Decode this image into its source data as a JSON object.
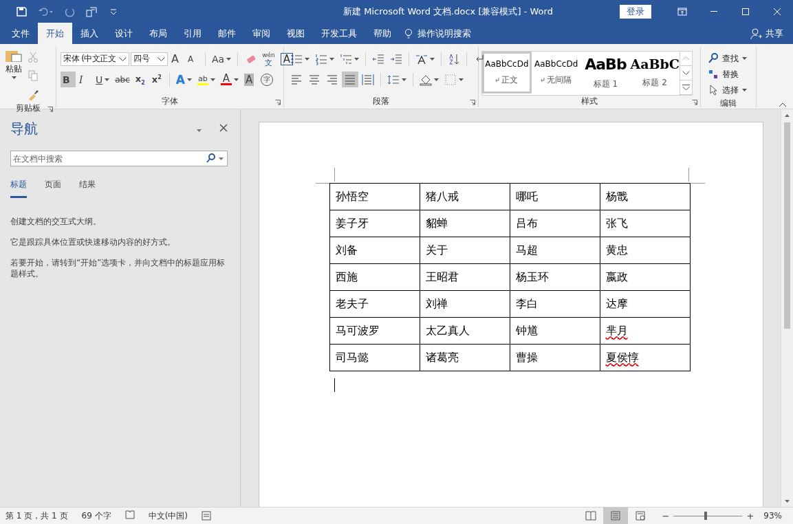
{
  "window": {
    "title": "新建 Microsoft Word 文档.docx [兼容模式]  -  Word",
    "signin": "登录"
  },
  "tabs": [
    {
      "label": "文件",
      "selected": false
    },
    {
      "label": "开始",
      "selected": true
    },
    {
      "label": "插入",
      "selected": false
    },
    {
      "label": "设计",
      "selected": false
    },
    {
      "label": "布局",
      "selected": false
    },
    {
      "label": "引用",
      "selected": false
    },
    {
      "label": "邮件",
      "selected": false
    },
    {
      "label": "审阅",
      "selected": false
    },
    {
      "label": "视图",
      "selected": false
    },
    {
      "label": "开发工具",
      "selected": false
    },
    {
      "label": "帮助",
      "selected": false
    }
  ],
  "tell_me": "操作说明搜索",
  "share": "共享",
  "clipboard": {
    "paste": "粘贴",
    "label": "剪贴板"
  },
  "font": {
    "label": "字体",
    "font_name": "宋体 (中文正文",
    "font_size": "四号",
    "row1": [
      {
        "kind": "grow",
        "text": "A"
      },
      {
        "kind": "shrink",
        "text": "A"
      },
      {
        "kind": "case",
        "text": "Aa",
        "dropdown": true,
        "sep": true
      },
      {
        "kind": "clear",
        "sep": true
      },
      {
        "kind": "phonetic",
        "text": "wén",
        "sub": "文"
      },
      {
        "kind": "border",
        "text": "A"
      }
    ],
    "row2": [
      {
        "kind": "bold",
        "text": "B",
        "selected": true
      },
      {
        "kind": "italic",
        "text": "I",
        "selected": false
      },
      {
        "kind": "underline",
        "text": "U",
        "selected": false,
        "dropdown": true
      },
      {
        "kind": "strike",
        "text": "abc",
        "selected": false
      },
      {
        "kind": "sub",
        "text": "x",
        "script": "2",
        "selected": false
      },
      {
        "kind": "sup",
        "text": "x",
        "script": "2",
        "selected": false
      },
      {
        "kind": "effect",
        "text": "A",
        "selected": false,
        "dropdown": true,
        "sep": true
      },
      {
        "kind": "highlight",
        "text": "ab",
        "color": "#ffff00",
        "selected": false,
        "dropdown": true
      },
      {
        "kind": "color",
        "text": "A",
        "color": "#ff0000",
        "selected": false,
        "dropdown": true
      },
      {
        "kind": "shade",
        "text": "A",
        "selected": false
      },
      {
        "kind": "enclose",
        "text": "字",
        "selected": false
      }
    ]
  },
  "paragraph": {
    "label": "段落",
    "alignments": [
      {
        "kind": "left",
        "selected": false
      },
      {
        "kind": "center",
        "selected": false
      },
      {
        "kind": "right",
        "selected": false
      },
      {
        "kind": "justify",
        "selected": true
      },
      {
        "kind": "distribute",
        "selected": false
      }
    ]
  },
  "styles": {
    "label": "样式",
    "items": [
      {
        "kind": "normal",
        "preview": "AaBbCcDd",
        "name": "正文",
        "selected": true
      },
      {
        "kind": "normal",
        "preview": "AaBbCcDd",
        "name": "无间隔",
        "selected": false
      },
      {
        "kind": "h1",
        "preview": "AaBb",
        "name": "标题 1",
        "selected": false
      },
      {
        "kind": "h2",
        "preview": "AaBbC",
        "name": "标题 2",
        "selected": false
      }
    ]
  },
  "editing": {
    "label": "编辑",
    "items": [
      {
        "kind": "find",
        "label": "查找",
        "dropdown": true
      },
      {
        "kind": "replace",
        "label": "替换",
        "dropdown": false
      },
      {
        "kind": "select",
        "label": "选择",
        "dropdown": true
      }
    ]
  },
  "navigation": {
    "title": "导航",
    "search": {
      "placeholder": "在文档中搜索"
    },
    "tabs": [
      {
        "label": "标题",
        "selected": true
      },
      {
        "label": "页面",
        "selected": false
      },
      {
        "label": "结果",
        "selected": false
      }
    ],
    "paragraphs": [
      "创建文档的交互式大纲。",
      "它是跟踪具体位置或快速移动内容的好方式。",
      "若要开始，请转到“开始”选项卡，并向文档中的标题应用标题样式。"
    ]
  },
  "table": {
    "rows": [
      [
        {
          "text": "孙悟空",
          "misspelled": false
        },
        {
          "text": "猪八戒",
          "misspelled": false
        },
        {
          "text": "哪吒",
          "misspelled": false
        },
        {
          "text": "杨戬",
          "misspelled": false
        }
      ],
      [
        {
          "text": "姜子牙",
          "misspelled": false
        },
        {
          "text": "貂蝉",
          "misspelled": false
        },
        {
          "text": "吕布",
          "misspelled": false
        },
        {
          "text": "张飞",
          "misspelled": false
        }
      ],
      [
        {
          "text": "刘备",
          "misspelled": false
        },
        {
          "text": "关于",
          "misspelled": false
        },
        {
          "text": "马超",
          "misspelled": false
        },
        {
          "text": "黄忠",
          "misspelled": false
        }
      ],
      [
        {
          "text": "西施",
          "misspelled": false
        },
        {
          "text": "王昭君",
          "misspelled": false
        },
        {
          "text": "杨玉环",
          "misspelled": false
        },
        {
          "text": "嬴政",
          "misspelled": false
        }
      ],
      [
        {
          "text": "老夫子",
          "misspelled": false
        },
        {
          "text": "刘禅",
          "misspelled": false
        },
        {
          "text": "李白",
          "misspelled": false
        },
        {
          "text": "达摩",
          "misspelled": false
        }
      ],
      [
        {
          "text": "马可波罗",
          "misspelled": false
        },
        {
          "text": "太乙真人",
          "misspelled": false
        },
        {
          "text": "钟馗",
          "misspelled": false
        },
        {
          "text": "芈月",
          "misspelled": true
        }
      ],
      [
        {
          "text": "司马懿",
          "misspelled": false
        },
        {
          "text": "诸葛亮",
          "misspelled": false
        },
        {
          "text": "曹操",
          "misspelled": false
        },
        {
          "text": "夏侯惇",
          "misspelled": true
        }
      ]
    ]
  },
  "status_bar": {
    "items": [
      "第 1 页，共 1 页",
      "69 个字",
      "中文(中国)"
    ],
    "views": [
      {
        "kind": "read",
        "selected": false
      },
      {
        "kind": "print",
        "selected": true
      },
      {
        "kind": "web",
        "selected": false
      }
    ],
    "zoom_out": "−",
    "zoom_in": "+",
    "zoom": {
      "level": 0.47
    },
    "zoom_text": "93%"
  }
}
